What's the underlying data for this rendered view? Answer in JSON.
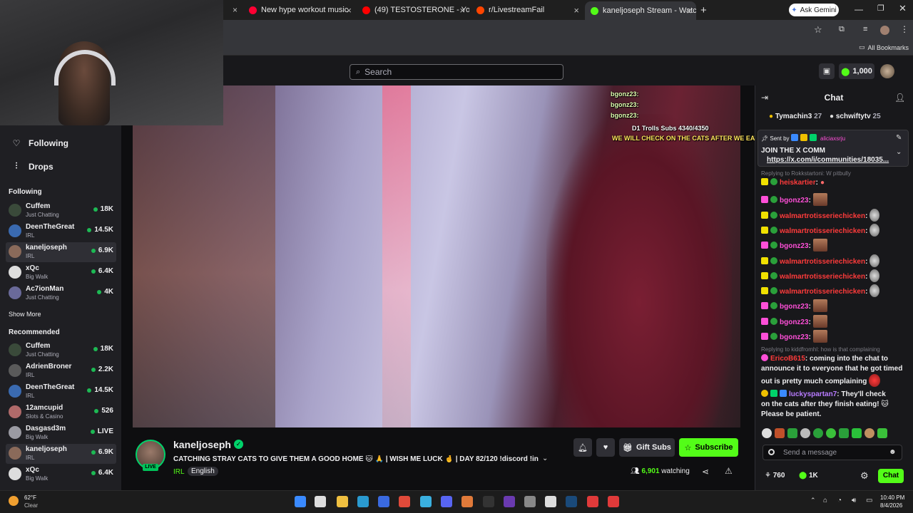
{
  "browser": {
    "tabs": [
      {
        "label": "New hype workout music",
        "color": "#ff0033"
      },
      {
        "label": "(49) TESTOSTERONE - YouTube",
        "color": "#ff0000"
      },
      {
        "label": "r/LivestreamFail",
        "color": "#ff4500"
      },
      {
        "label": "kaneljoseph Stream - Watc",
        "color": "#53fc18"
      }
    ],
    "new_tab": "+",
    "ask_gemini": "Ask Gemini",
    "all_bookmarks": "All Bookmarks"
  },
  "topnav": {
    "search_placeholder": "Search",
    "points": "1,000"
  },
  "sidebar": {
    "nav": [
      {
        "label": "Following",
        "icon": "heart-icon"
      },
      {
        "label": "Drops",
        "icon": "drops-icon"
      }
    ],
    "following_title": "Following",
    "following": [
      {
        "name": "Cuffem",
        "category": "Just Chatting",
        "viewers": "18K",
        "color": "#3a4a3a"
      },
      {
        "name": "DeenTheGreat",
        "category": "IRL",
        "viewers": "14.5K",
        "color": "#3a6ab0"
      },
      {
        "name": "kaneljoseph",
        "category": "IRL",
        "viewers": "6.9K",
        "color": "#8a6a5a"
      },
      {
        "name": "xQc",
        "category": "Big Walk",
        "viewers": "6.4K",
        "color": "#ddd"
      },
      {
        "name": "Ac7ionMan",
        "category": "Just Chatting",
        "viewers": "4K",
        "color": "#6a6a9a"
      }
    ],
    "show_more": "Show More",
    "recommended_title": "Recommended",
    "recommended": [
      {
        "name": "Cuffem",
        "category": "Just Chatting",
        "viewers": "18K",
        "color": "#3a4a3a"
      },
      {
        "name": "AdrienBroner",
        "category": "IRL",
        "viewers": "2.2K",
        "color": "#5a5a5a"
      },
      {
        "name": "DeenTheGreat",
        "category": "IRL",
        "viewers": "14.5K",
        "color": "#3a6ab0"
      },
      {
        "name": "12amcupid",
        "category": "Slots & Casino",
        "viewers": "526",
        "color": "#b06a6a"
      },
      {
        "name": "Dasgasd3m",
        "category": "Big Walk",
        "viewers": "LIVE",
        "color": "#9a9aa2"
      },
      {
        "name": "kaneljoseph",
        "category": "IRL",
        "viewers": "6.9K",
        "color": "#8a6a5a"
      },
      {
        "name": "xQc",
        "category": "Big Walk",
        "viewers": "6.4K",
        "color": "#ddd"
      }
    ]
  },
  "video_overlay": {
    "chat_lines": [
      "bgonz23:",
      "bgonz23:",
      "bgonz23:"
    ],
    "subs": "D1 Trolls Subs 4340/4350",
    "banner": "WE WILL CHECK ON THE CATS AFTER WE EAT"
  },
  "stream": {
    "streamer": "kaneljoseph",
    "live": "LIVE",
    "title": "CATCHING STRAY CATS TO GIVE THEM A GOOD HOME 🐱 🙏 | WISH ME LUCK 🤞 | DAY 82/120 !discord !insta !...",
    "category": "IRL",
    "language": "English",
    "gift_subs": "Gift Subs",
    "subscribe": "Subscribe",
    "viewers": "6,901",
    "watching": "watching"
  },
  "chat": {
    "title": "Chat",
    "top_gifters": [
      {
        "name": "Tymachin3",
        "count": "27"
      },
      {
        "name": "schwiftytv",
        "count": "25"
      }
    ],
    "pinned": {
      "sent_by_label": "Sent by",
      "sender": "aliciaxsrju",
      "text": "JOIN THE X COMM",
      "link": "https://x.com/i/communities/18035..."
    },
    "messages": [
      {
        "type": "reply",
        "text": "Replying to Rokkstartoni: W pitbully"
      },
      {
        "type": "msg",
        "user": "heiskartier",
        "userClass": "u-red",
        "text": ":",
        "emote": false
      },
      {
        "type": "msg",
        "user": "bgonz23",
        "userClass": "u-pink",
        "text": ":",
        "emote": true
      },
      {
        "type": "msg",
        "user": "walmartrotisseriechicken",
        "userClass": "u-red",
        "text": ":",
        "emote": "skull"
      },
      {
        "type": "msg",
        "user": "walmartrotisseriechicken",
        "userClass": "u-red",
        "text": ":",
        "emote": "skull"
      },
      {
        "type": "msg",
        "user": "bgonz23",
        "userClass": "u-pink",
        "text": ":",
        "emote": true
      },
      {
        "type": "msg",
        "user": "walmartrotisseriechicken",
        "userClass": "u-red",
        "text": ":",
        "emote": "skull"
      },
      {
        "type": "msg",
        "user": "walmartrotisseriechicken",
        "userClass": "u-red",
        "text": ":",
        "emote": "skull"
      },
      {
        "type": "msg",
        "user": "walmartrotisseriechicken",
        "userClass": "u-red",
        "text": ":",
        "emote": "skull"
      },
      {
        "type": "msg",
        "user": "bgonz23",
        "userClass": "u-pink",
        "text": ":",
        "emote": true
      },
      {
        "type": "msg",
        "user": "bgonz23",
        "userClass": "u-pink",
        "text": ":",
        "emote": true
      },
      {
        "type": "msg",
        "user": "bgonz23",
        "userClass": "u-pink",
        "text": ":",
        "emote": true
      }
    ],
    "reply2": "Replying to kiddfromhl: how is that complaining",
    "erico": {
      "user": "EricoB615",
      "lines": [
        "coming into the chat to",
        "announce it to everyone that he got timed",
        "out is pretty much complaining"
      ]
    },
    "lucky": {
      "user": "luckyspartan7",
      "lines": [
        "They'll check",
        "on the cats after they finish eating! 🐱",
        "Please be patient."
      ]
    },
    "input_placeholder": "Send a message",
    "points_a": "760",
    "points_b": "1K",
    "chat_button": "Chat"
  },
  "taskbar": {
    "weather_temp": "62°F",
    "weather_desc": "Clear",
    "time": "10:40 PM",
    "date": "8/4/2026"
  }
}
